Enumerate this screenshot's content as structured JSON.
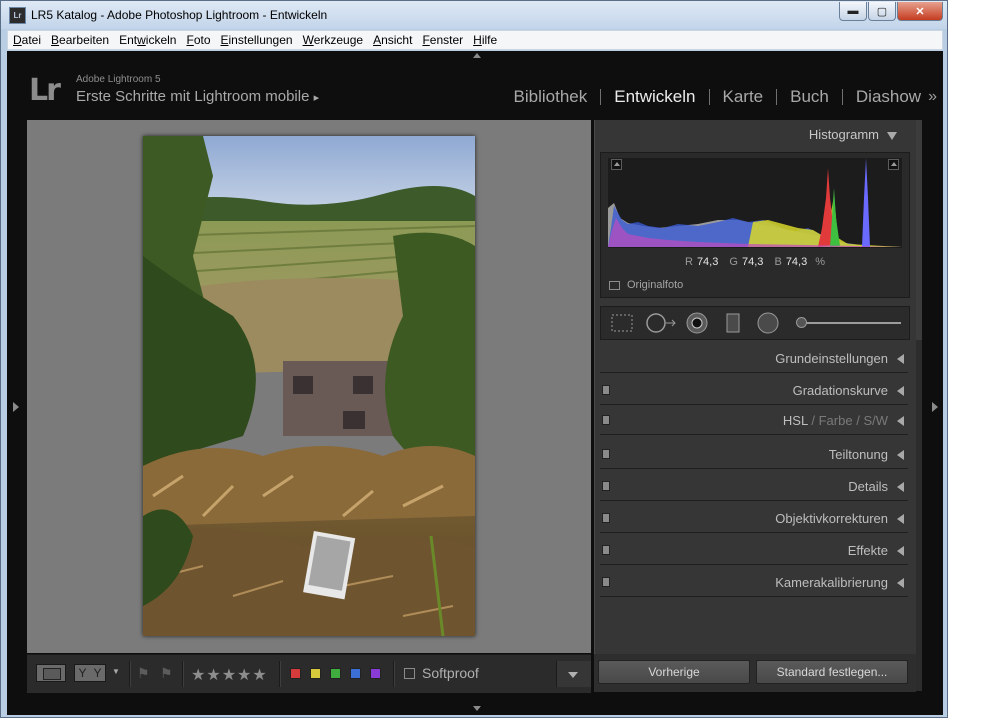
{
  "window": {
    "title": "LR5 Katalog - Adobe Photoshop Lightroom - Entwickeln",
    "app_icon": "Lr",
    "controls": {
      "minimize": "▬",
      "maximize": "▢",
      "close": "✕"
    }
  },
  "menu": [
    {
      "pre": "",
      "u": "D",
      "post": "atei"
    },
    {
      "pre": "",
      "u": "B",
      "post": "earbeiten"
    },
    {
      "pre": "Ent",
      "u": "w",
      "post": "ickeln"
    },
    {
      "pre": "",
      "u": "F",
      "post": "oto"
    },
    {
      "pre": "",
      "u": "E",
      "post": "instellungen"
    },
    {
      "pre": "",
      "u": "W",
      "post": "erkzeuge"
    },
    {
      "pre": "",
      "u": "A",
      "post": "nsicht"
    },
    {
      "pre": "",
      "u": "F",
      "post": "enster"
    },
    {
      "pre": "",
      "u": "H",
      "post": "ilfe"
    }
  ],
  "identity": {
    "logo": "Lr",
    "product": "Adobe Lightroom 5",
    "catalog": "Erste Schritte mit Lightroom mobile",
    "catalog_arrow": "▸"
  },
  "modules": [
    "Bibliothek",
    "Entwickeln",
    "Karte",
    "Buch",
    "Diashow"
  ],
  "active_module": "Entwickeln",
  "modules_more": "»",
  "histogram": {
    "title": "Histogramm",
    "r_label": "R",
    "r_value": "74,3",
    "g_label": "G",
    "g_value": "74,3",
    "b_label": "B",
    "b_value": "74,3",
    "unit": "%",
    "original_label": "Originalfoto"
  },
  "sections": {
    "grund": "Grundeinstellungen",
    "grad": "Gradationskurve",
    "hsl": "HSL",
    "hsl_slash1": "/",
    "farbe": "Farbe",
    "hsl_slash2": "/",
    "sw": "S/W",
    "teil": "Teiltonung",
    "details": "Details",
    "objektiv": "Objektivkorrekturen",
    "effekte": "Effekte",
    "kamera": "Kamerakalibrierung"
  },
  "toolbar": {
    "yy_1": "Y",
    "yy_2": "Y",
    "stars": "★★★★★",
    "softproof": "Softproof",
    "color_labels": [
      "#d63b3b",
      "#d6c93b",
      "#3fae3f",
      "#3b6fd6",
      "#8a3bd6"
    ]
  },
  "buttons": {
    "previous": "Vorherige",
    "set_default": "Standard festlegen..."
  }
}
